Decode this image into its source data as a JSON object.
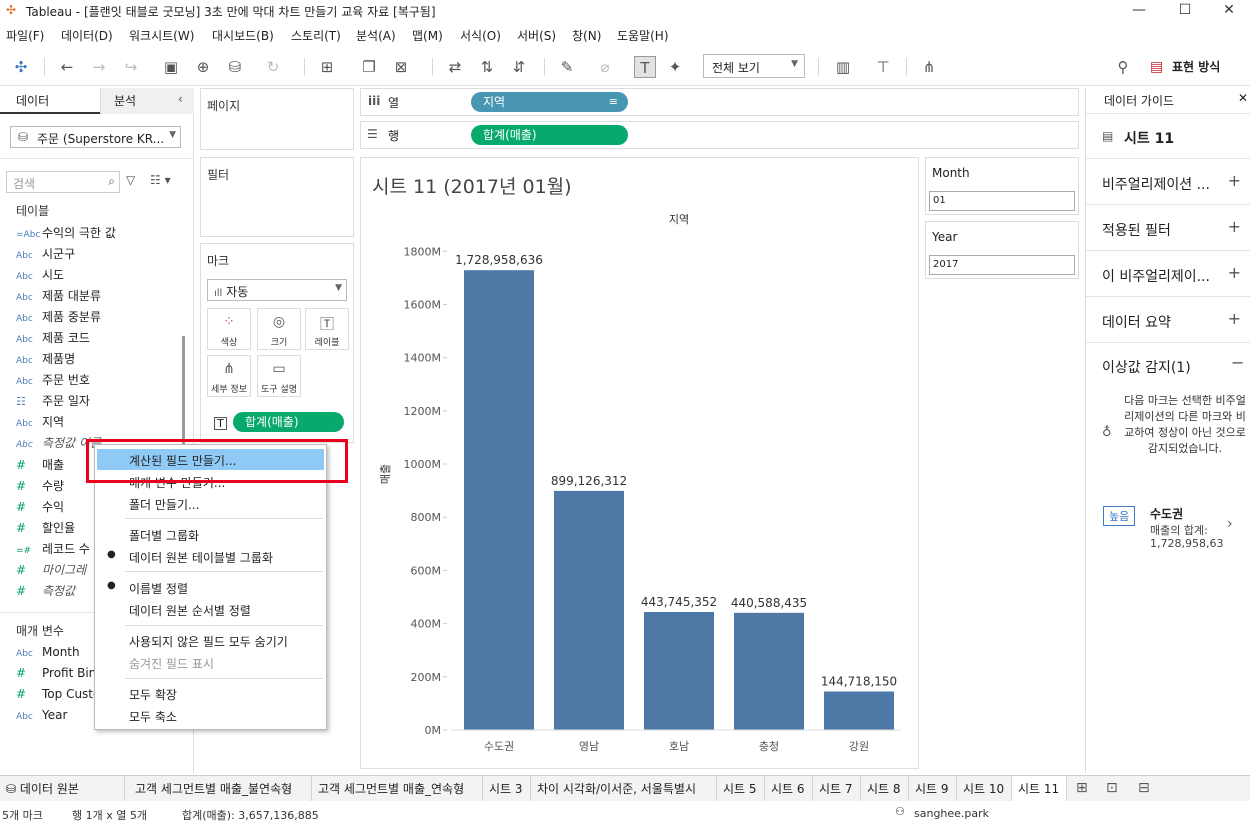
{
  "window": {
    "title": "Tableau - [플랜잇 태블로 굿모닝] 3초 만에 막대 차트 만들기 교육 자료 [복구됨]"
  },
  "menu": [
    "파일(F)",
    "데이터(D)",
    "워크시트(W)",
    "대시보드(B)",
    "스토리(T)",
    "분석(A)",
    "맵(M)",
    "서식(O)",
    "서버(S)",
    "창(N)",
    "도움말(H)"
  ],
  "toolbar": {
    "view_select": "전체 보기",
    "show_me": "표현 방식"
  },
  "data_pane": {
    "tab_data": "데이터",
    "tab_analysis": "분석",
    "datasource": "주문 (Superstore KR...",
    "search_placeholder": "검색",
    "tables_header": "테이블",
    "fields": [
      {
        "type": "=Abc",
        "name": "수익의 극한 값"
      },
      {
        "type": "Abc",
        "name": "시군구"
      },
      {
        "type": "Abc",
        "name": "시도"
      },
      {
        "type": "Abc",
        "name": "제품 대분류"
      },
      {
        "type": "Abc",
        "name": "제품 중분류"
      },
      {
        "type": "Abc",
        "name": "제품 코드"
      },
      {
        "type": "Abc",
        "name": "제품명"
      },
      {
        "type": "Abc",
        "name": "주문 번호"
      },
      {
        "type": "cal",
        "name": "주문 일자"
      },
      {
        "type": "Abc",
        "name": "지역"
      },
      {
        "type": "Abc",
        "name": "측정값 이름"
      },
      {
        "type": "#",
        "name": "매출"
      },
      {
        "type": "#",
        "name": "수량"
      },
      {
        "type": "#",
        "name": "수익"
      },
      {
        "type": "#",
        "name": "할인율"
      },
      {
        "type": "=#",
        "name": "레코드 수"
      },
      {
        "type": "#",
        "name": "마이그레"
      },
      {
        "type": "#",
        "name": "측정값"
      }
    ],
    "params_header": "매개 변수",
    "params": [
      {
        "type": "Abc",
        "name": "Month"
      },
      {
        "type": "#",
        "name": "Profit Bin"
      },
      {
        "type": "#",
        "name": "Top Custo"
      },
      {
        "type": "Abc",
        "name": "Year"
      }
    ]
  },
  "shelves": {
    "pages": "페이지",
    "filters": "필터",
    "marks": "마크",
    "mark_type": "자동",
    "mark_buttons": [
      "색상",
      "크기",
      "레이블",
      "세부 정보",
      "도구 설명"
    ],
    "mark_pill": "합계(매출)",
    "columns_label": "열",
    "columns_pill": "지역",
    "rows_label": "행",
    "rows_pill": "합계(매출)"
  },
  "sheet": {
    "title": "시트 11 (2017년 01월)"
  },
  "filters_panel": {
    "month_label": "Month",
    "month_value": "01",
    "year_label": "Year",
    "year_value": "2017"
  },
  "chart_data": {
    "type": "bar",
    "title": "",
    "xlabel": "지역",
    "ylabel": "매출",
    "categories": [
      "수도권",
      "영남",
      "호남",
      "충청",
      "강원"
    ],
    "values": [
      1728958636,
      899126312,
      443745352,
      440588435,
      144718150
    ],
    "data_labels": [
      "1,728,958,636",
      "899,126,312",
      "443,745,352",
      "440,588,435",
      "144,718,150"
    ],
    "yticks": [
      "0M",
      "200M",
      "400M",
      "600M",
      "800M",
      "1000M",
      "1200M",
      "1400M",
      "1600M",
      "1800M"
    ],
    "ylim": [
      0,
      1850000000
    ],
    "bar_color": "#4e79a7",
    "grid": false
  },
  "guide": {
    "title": "데이터 가이드",
    "sheet": "시트 11",
    "rows": [
      "비주얼리제이션 ...",
      "적용된 필터",
      "이 비주얼리제이...",
      "데이터 요약",
      "이상값 감지(1)"
    ],
    "outlier_text": "다음 마크는 선택한 비주얼리제이션의 다른 마크와 비교하여 정상이 아닌 것으로 감지되었습니다.",
    "badge": "높음",
    "outlier_name": "수도권",
    "outlier_line1": "매출의 합계:",
    "outlier_line2": "1,728,958,63"
  },
  "tabs": [
    "데이터 원본",
    "고객 세그먼트별 매출_불연속형",
    "고객 세그먼트별 매출_연속형",
    "시트 3",
    "차이 시각화/이서준, 서울특별시",
    "시트 5",
    "시트 6",
    "시트 7",
    "시트 8",
    "시트 9",
    "시트 10",
    "시트 11"
  ],
  "status": {
    "marks": "5개 마크",
    "rows_cols": "행 1개 x 열 5개",
    "sum": "합계(매출): 3,657,136,885",
    "user": "sanghee.park"
  },
  "context_menu": {
    "items": [
      "계산된 필드 만들기...",
      "매개 변수 만들기...",
      "폴더 만들기...",
      "폴더별 그룹화",
      "데이터 원본 테이블별 그룹화",
      "이름별 정렬",
      "데이터 원본 순서별 정렬",
      "사용되지 않은 필드 모두 숨기기",
      "숨겨진 필드 표시",
      "모두 확장",
      "모두 축소"
    ]
  }
}
